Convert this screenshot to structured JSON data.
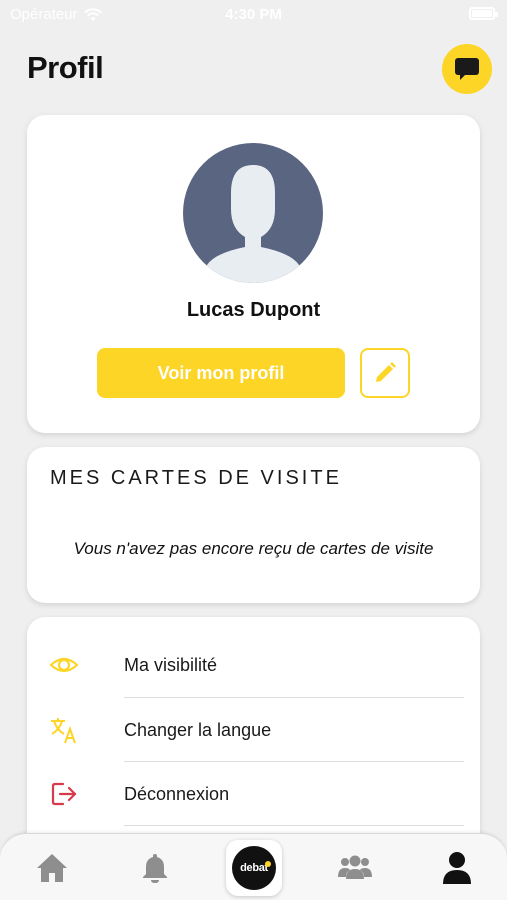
{
  "status_bar": {
    "carrier": "Opérateur",
    "time": "4:30 PM"
  },
  "header": {
    "title": "Profil",
    "chat_icon": "chat-bubble-icon"
  },
  "profile": {
    "name": "Lucas Dupont",
    "view_profile_label": "Voir mon profil",
    "edit_icon": "pencil-icon"
  },
  "business_cards": {
    "title": "MES CARTES DE VISITE",
    "empty_message": "Vous n'avez pas encore reçu de cartes de visite"
  },
  "menu": {
    "items": [
      {
        "label": "Ma visibilité",
        "icon": "eye-icon"
      },
      {
        "label": "Changer la langue",
        "icon": "translate-icon"
      },
      {
        "label": "Déconnexion",
        "icon": "logout-icon"
      }
    ]
  },
  "tab_bar": {
    "tabs": [
      "home-icon",
      "bell-icon",
      "debate-logo",
      "group-icon",
      "person-icon"
    ],
    "logo_text": "debat"
  },
  "colors": {
    "accent": "#fdd526",
    "logout": "#d63b4b",
    "avatar_bg": "#5a6582",
    "tab_active": "#111111",
    "tab_inactive": "#8e8e8e"
  }
}
